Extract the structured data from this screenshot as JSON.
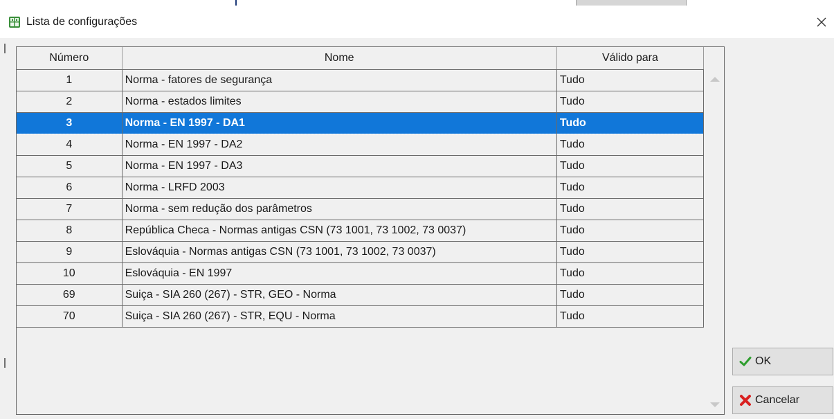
{
  "window": {
    "title": "Lista de configurações"
  },
  "table": {
    "columns": [
      "Número",
      "Nome",
      "Válido para"
    ],
    "rows": [
      {
        "numero": "1",
        "nome": "Norma - fatores de segurança",
        "valido": "Tudo"
      },
      {
        "numero": "2",
        "nome": "Norma - estados limites",
        "valido": "Tudo"
      },
      {
        "numero": "3",
        "nome": "Norma - EN 1997 - DA1",
        "valido": "Tudo"
      },
      {
        "numero": "4",
        "nome": "Norma - EN 1997 - DA2",
        "valido": "Tudo"
      },
      {
        "numero": "5",
        "nome": "Norma - EN 1997 - DA3",
        "valido": "Tudo"
      },
      {
        "numero": "6",
        "nome": "Norma - LRFD 2003",
        "valido": "Tudo"
      },
      {
        "numero": "7",
        "nome": "Norma - sem redução dos parâmetros",
        "valido": "Tudo"
      },
      {
        "numero": "8",
        "nome": "República Checa - Normas antigas CSN (73 1001, 73 1002, 73 0037)",
        "valido": "Tudo"
      },
      {
        "numero": "9",
        "nome": "Eslováquia - Normas antigas CSN (73 1001, 73 1002, 73 0037)",
        "valido": "Tudo"
      },
      {
        "numero": "10",
        "nome": "Eslováquia - EN 1997",
        "valido": "Tudo"
      },
      {
        "numero": "69",
        "nome": "Suiça - SIA 260 (267) - STR, GEO - Norma",
        "valido": "Tudo"
      },
      {
        "numero": "70",
        "nome": "Suiça - SIA 260 (267) - STR, EQU - Norma",
        "valido": "Tudo"
      }
    ],
    "selected_index": 2
  },
  "buttons": {
    "ok_label": "OK",
    "cancel_label": "Cancelar"
  },
  "icons": {
    "window": "config-list-icon",
    "close": "close-icon",
    "ok": "checkmark-icon",
    "cancel": "red-x-icon"
  },
  "colors": {
    "selection": "#1177d9",
    "ok_check": "#2e9e2e",
    "cancel_x": "#d92020"
  }
}
